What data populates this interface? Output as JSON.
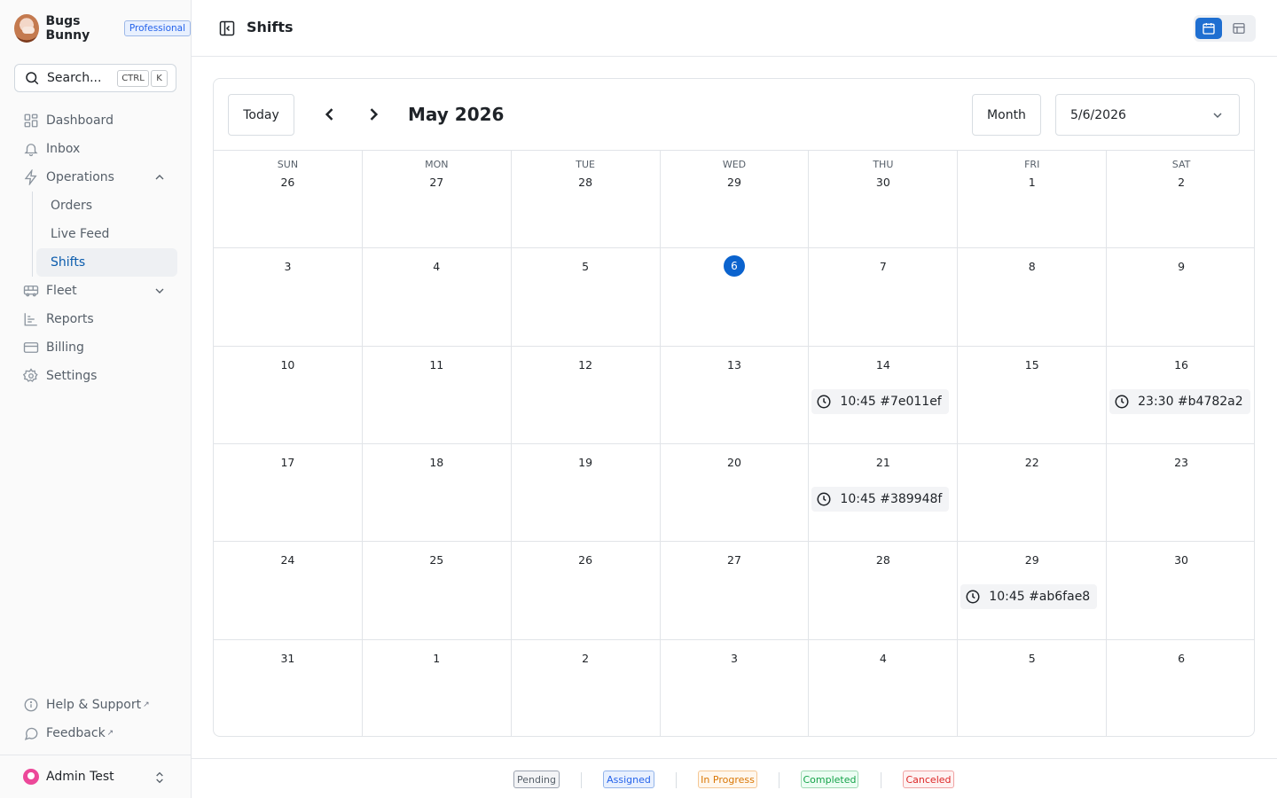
{
  "org": {
    "name": "Bugs Bunny",
    "plan": "Professional"
  },
  "search": {
    "label": "Search...",
    "kbd_ctrl": "CTRL",
    "kbd_k": "K"
  },
  "nav": {
    "dashboard": "Dashboard",
    "inbox": "Inbox",
    "operations": "Operations",
    "operations_children": [
      "Orders",
      "Live Feed",
      "Shifts"
    ],
    "fleet": "Fleet",
    "reports": "Reports",
    "billing": "Billing",
    "settings": "Settings"
  },
  "footer_links": {
    "help": "Help & Support",
    "feedback": "Feedback"
  },
  "user": {
    "name": "Admin Test"
  },
  "header": {
    "title": "Shifts"
  },
  "calendar": {
    "today_label": "Today",
    "title": "May 2026",
    "view_label": "Month",
    "date_value": "5/6/2026",
    "weekdays": [
      "SUN",
      "MON",
      "TUE",
      "WED",
      "THU",
      "FRI",
      "SAT"
    ],
    "weeks": [
      [
        "26",
        "27",
        "28",
        "29",
        "30",
        "1",
        "2"
      ],
      [
        "3",
        "4",
        "5",
        "6",
        "7",
        "8",
        "9"
      ],
      [
        "10",
        "11",
        "12",
        "13",
        "14",
        "15",
        "16"
      ],
      [
        "17",
        "18",
        "19",
        "20",
        "21",
        "22",
        "23"
      ],
      [
        "24",
        "25",
        "26",
        "27",
        "28",
        "29",
        "30"
      ],
      [
        "31",
        "1",
        "2",
        "3",
        "4",
        "5",
        "6"
      ]
    ],
    "today_cell": "6",
    "events": [
      {
        "week": 2,
        "day": 4,
        "text": "10:45 #7e011ef"
      },
      {
        "week": 2,
        "day": 6,
        "text": "23:30 #b4782a2"
      },
      {
        "week": 3,
        "day": 4,
        "text": "10:45 #389948f"
      },
      {
        "week": 4,
        "day": 5,
        "text": "10:45 #ab6fae8"
      }
    ]
  },
  "legend": [
    {
      "label": "Pending",
      "color": "#57606a",
      "bg": "#f3f4f6",
      "border": "#9ca3af"
    },
    {
      "label": "Assigned",
      "color": "#2563eb",
      "bg": "#e8f0fe",
      "border": "#93b4ea"
    },
    {
      "label": "In Progress",
      "color": "#d97706",
      "bg": "#fff7ed",
      "border": "#f5c794"
    },
    {
      "label": "Completed",
      "color": "#16a34a",
      "bg": "#ecfdf3",
      "border": "#9ed9b3"
    },
    {
      "label": "Canceled",
      "color": "#dc2626",
      "bg": "#fef2f2",
      "border": "#f0a3a3"
    }
  ],
  "colors": {
    "accent": "#0b63ce",
    "active_nav": "#0b5cad"
  }
}
